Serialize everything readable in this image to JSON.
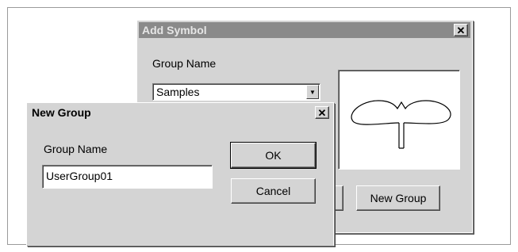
{
  "add_symbol": {
    "title": "Add Symbol",
    "group_label": "Group Name",
    "group_value": "Samples",
    "new_group_button": "New Group",
    "close_glyph": "✕"
  },
  "new_group": {
    "title": "New Group",
    "group_label": "Group Name",
    "group_value": "UserGroup01",
    "ok_button": "OK",
    "cancel_button": "Cancel",
    "close_glyph": "✕"
  },
  "icons": {
    "dropdown": "chevron-down-icon",
    "close": "close-icon",
    "preview": "symbol-preview-icon"
  }
}
